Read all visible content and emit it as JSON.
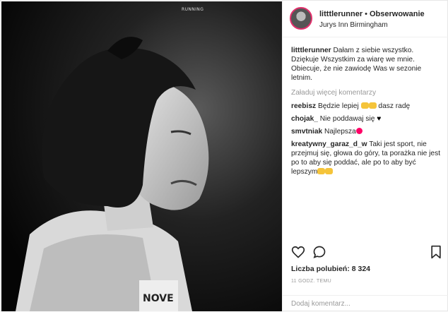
{
  "photo": {
    "watermark": "RUNNING"
  },
  "header": {
    "username": "litttlerunner",
    "separator": "•",
    "follow_label": "Obserwowanie",
    "location": "Jurys Inn Birmingham"
  },
  "caption": {
    "username": "litttlerunner",
    "text": "Dałam z siebie wszystko. Dziękuje Wszystkim za wiarę we mnie. Obiecuje, że nie zawiodę Was w sezonie letnim."
  },
  "load_more_label": "Załaduj więcej komentarzy",
  "comments": [
    {
      "user": "reebisz",
      "text": "Będzie lepiej",
      "after": "dasz radę"
    },
    {
      "user": "chojak_",
      "text": "Nie poddawaj się",
      "after": ""
    },
    {
      "user": "smvtniak",
      "text": "Najlepsza",
      "after": ""
    },
    {
      "user": "kreatywny_garaz_d_w",
      "text": "Taki jest sport, nie przejmuj się, głowa do góry, ta porażka nie jest po to aby się poddać, ale po to aby być lepszym",
      "after": ""
    }
  ],
  "actions": {
    "like_icon": "heart-icon",
    "comment_icon": "comment-bubble-icon",
    "save_icon": "bookmark-icon"
  },
  "likes_text": "Liczba polubień: 8 324",
  "timestamp": "11 GODZ. TEMU",
  "add_comment_placeholder": "Dodaj komentarz...",
  "colors": {
    "story_ring": "#e1306c",
    "muted_text": "#999999",
    "border": "#efefef"
  }
}
